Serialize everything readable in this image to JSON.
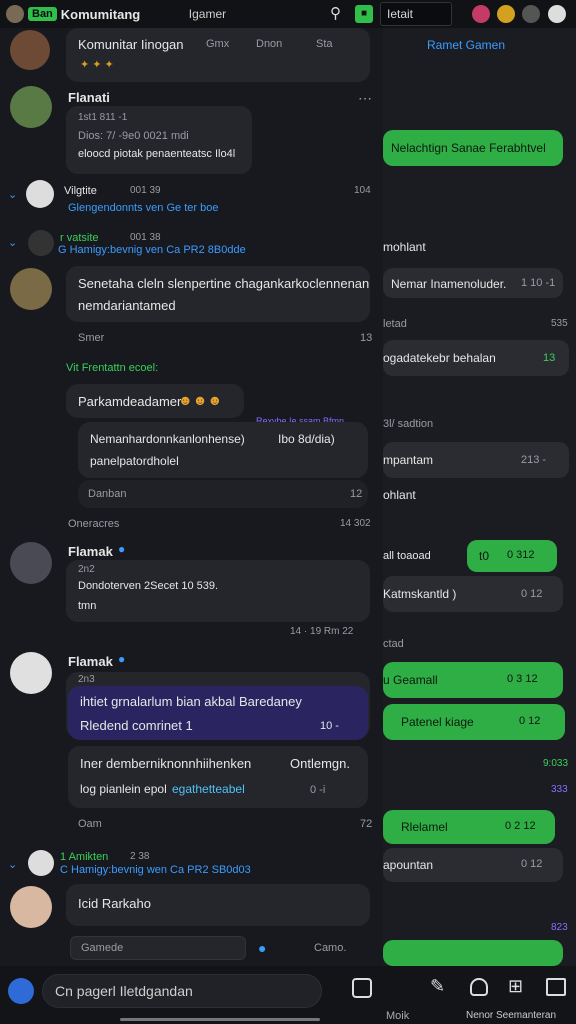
{
  "topbar": {
    "tag": "Ban",
    "title": "Komumitang",
    "search_value": "Igamer",
    "field_value": "Ietait"
  },
  "left": {
    "post1": {
      "title": "Komunitar Iinogan",
      "action1": "Gmx",
      "action2": "Dnon",
      "action3": "Sta"
    },
    "msg1": {
      "name": "Flanati",
      "meta": "1st1  811 -1",
      "line1": "Dios: 7/ -9e0 0021 mdi",
      "line2": "eloocd piotak penaenteatsc Ilo4l"
    },
    "thread1": {
      "name": "Vilgtite",
      "time": "001 39",
      "right": "104",
      "link": "Glengendonnts ven Ge ter boe"
    },
    "thread2": {
      "name": "r vatsite",
      "time": "001 38",
      "link": "G Hamigy:bevnig ven Ca PR2 8B0dde"
    },
    "msg2": {
      "line1": "Senetaha cleln slenpertine chagankarkoclennenan",
      "line2": "nemdariantamed",
      "footer_left": "Smer",
      "footer_right": "13"
    },
    "system_note": "Vit Frentattn ecoel:",
    "msg3": {
      "text": "Parkamdeadamer",
      "tag_label": "Rexvbe Ie ssam Bfmn",
      "quote1": "Nemanhardonnkanlonhense)",
      "quote1b": "Ibo 8d/dia)",
      "quote2": "panelpatordholel",
      "footer_left": "Danban",
      "footer_right": "12"
    },
    "divider": {
      "label": "Oneracres",
      "time": "14 302"
    },
    "msg4": {
      "name": "Flamak",
      "meta": "2n2",
      "line1": "Dondoterven 2Secet 10 539.",
      "line2": "tmn",
      "footer": "14 · 19 Rm 22"
    },
    "msg5": {
      "name": "Flamak",
      "meta": "2n3",
      "line1": "ihtiet grnalarlum bian akbal Baredaney",
      "line2": "Rledend comrinet 1",
      "count": "10 -",
      "line3": "Iner demberniknonnhiihenken",
      "line3b": "Ontlemgn.",
      "line4": "log pianlein epol",
      "line4b": "egathetteabel",
      "line4c": "0 -i",
      "footer_left": "Oam",
      "footer_right": "72"
    },
    "thread3": {
      "name": "1 Amikten",
      "time": "2 38",
      "link": "C Hamigy:bevnig wen Ca PR2 SB0d03"
    },
    "msg6": {
      "text": "Icid Rarkaho"
    },
    "search": {
      "placeholder": "Gamede",
      "right": "Camo."
    }
  },
  "right": {
    "header": "Ramet Gamen",
    "b1": "Nelachtign Sanae Ferabhtvel",
    "l1": "mohlant",
    "b2": "Nemar Inamenoluder.",
    "b2_time": "1 10 -1",
    "l2": "letad",
    "l2_time": "535",
    "b3": "ogadatekebr behalan",
    "b3_time": "13",
    "l3": "3l/ sadtion",
    "b4": "mpantam",
    "b4_time": "213 -",
    "l4": "ohlant",
    "b5": "t0",
    "b5_time": "0 312",
    "l5": "all toaoad",
    "b6": "Katmskantld )",
    "b6_time": "0 12",
    "l6": "ctad",
    "b7": "u Geamall",
    "b7_time": "0 3 12",
    "b8": "Patenel kiage",
    "b8_time": "0 12",
    "time1": "9:033",
    "time2": "333",
    "b9": "Rlelamel",
    "b9_time": "0 2 12",
    "b10": "apountan",
    "b10_time": "0 12",
    "time3": "823",
    "bottom_label": "Nenor Seemanteran"
  },
  "bottom": {
    "compose_placeholder": "Cn pagerl Iletdgandan",
    "right_label_left": "Moik"
  }
}
